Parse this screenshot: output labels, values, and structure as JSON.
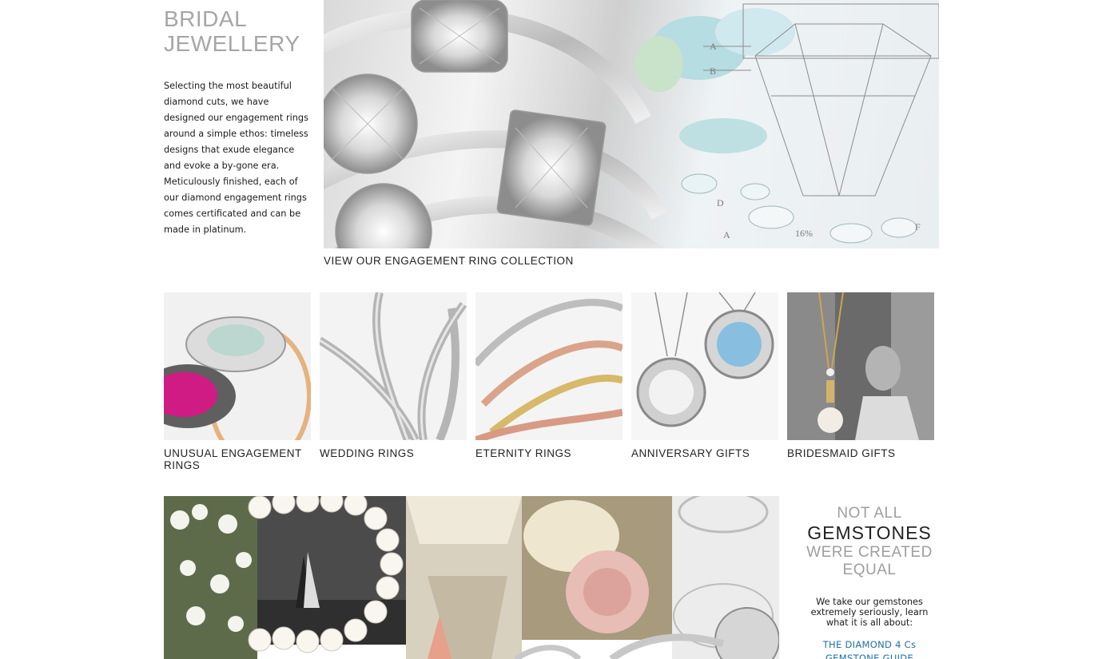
{
  "page": {
    "title_line1": "BRIDAL",
    "title_line2": "JEWELLERY",
    "intro": "Selecting the most beautiful diamond cuts, we have designed our engagement rings around a simple ethos: timeless designs that exude elegance and evoke a by-gone era. Meticulously finished, each of our diamond engagement rings comes certificated and can be made in platinum."
  },
  "hero": {
    "link_label": "VIEW OUR ENGAGEMENT RING COLLECTION",
    "diagram_letters": [
      "A",
      "B",
      "D",
      "A",
      "F"
    ],
    "diagram_percent": "16%"
  },
  "categories": [
    {
      "label": "UNUSUAL ENGAGEMENT RINGS"
    },
    {
      "label": "WEDDING RINGS"
    },
    {
      "label": "ETERNITY RINGS"
    },
    {
      "label": "ANNIVERSARY GIFTS"
    },
    {
      "label": "BRIDESMAID GIFTS"
    }
  ],
  "promo": {
    "heading_line1": "NOT ALL",
    "heading_line2": "GEMSTONES",
    "heading_line3": "WERE CREATED",
    "heading_line4": "EQUAL",
    "body": "We take our gemstones extremely seriously, learn what it is all about:",
    "links": [
      "THE DIAMOND 4 Cs",
      "GEMSTONE GUIDE"
    ]
  },
  "colors": {
    "heading_grey": "#a6a6a6",
    "link_blue": "#1e6fa3",
    "text": "#222222"
  }
}
